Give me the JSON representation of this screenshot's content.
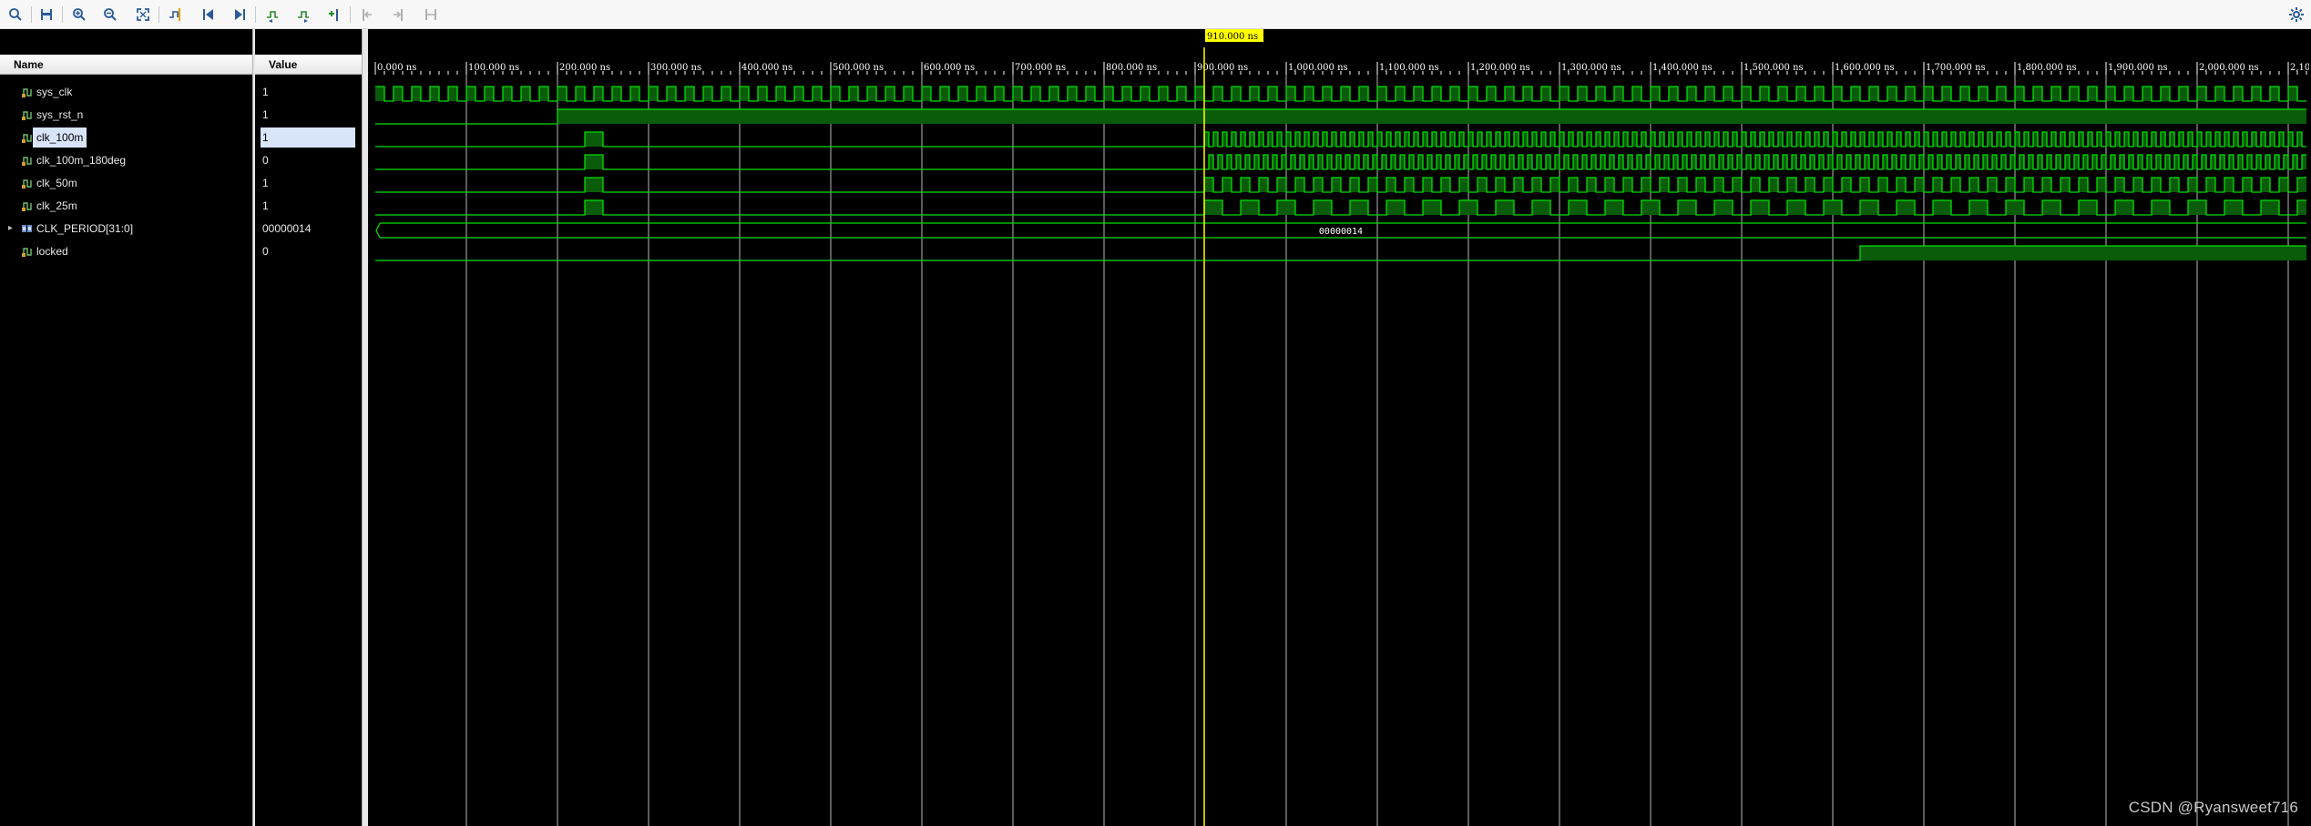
{
  "toolbar": {
    "buttons": [
      {
        "name": "zoom-search-icon"
      },
      {
        "name": "save-icon"
      },
      {
        "name": "zoom-in-icon"
      },
      {
        "name": "zoom-out-icon"
      },
      {
        "name": "zoom-fit-icon"
      },
      {
        "name": "go-to-cursor-icon"
      },
      {
        "name": "go-to-time-zero-icon"
      },
      {
        "name": "go-to-last-time-icon"
      },
      {
        "name": "previous-transition-icon"
      },
      {
        "name": "next-transition-icon"
      },
      {
        "name": "add-marker-icon"
      },
      {
        "name": "previous-marker-icon"
      },
      {
        "name": "next-marker-icon"
      },
      {
        "name": "swap-cursors-icon"
      }
    ],
    "settings_icon": "gear-icon"
  },
  "columns": {
    "name_header": "Name",
    "value_header": "Value"
  },
  "signals": [
    {
      "name": "sys_clk",
      "value": "1",
      "type": "bit",
      "icon": "bit-signal-icon"
    },
    {
      "name": "sys_rst_n",
      "value": "1",
      "type": "bit",
      "icon": "bit-signal-icon"
    },
    {
      "name": "clk_100m",
      "value": "1",
      "type": "bit",
      "icon": "bit-signal-icon",
      "selected": true
    },
    {
      "name": "clk_100m_180deg",
      "value": "0",
      "type": "bit",
      "icon": "bit-signal-icon"
    },
    {
      "name": "clk_50m",
      "value": "1",
      "type": "bit",
      "icon": "bit-signal-icon"
    },
    {
      "name": "clk_25m",
      "value": "1",
      "type": "bit",
      "icon": "bit-signal-icon"
    },
    {
      "name": "CLK_PERIOD[31:0]",
      "value": "00000014",
      "type": "bus",
      "icon": "bus-signal-icon",
      "bus_label": "00000014"
    },
    {
      "name": "locked",
      "value": "0",
      "type": "bit",
      "icon": "bit-signal-icon"
    }
  ],
  "timeline": {
    "unit": "ns",
    "start": 0,
    "end": 2120,
    "major_step": 100,
    "tick_labels": [
      "0.000 ns",
      "100.000 ns",
      "200.000 ns",
      "300.000 ns",
      "400.000 ns",
      "500.000 ns",
      "600.000 ns",
      "700.000 ns",
      "800.000 ns",
      "900.000 ns",
      "1,000.000 ns",
      "1,100.000 ns",
      "1,200.000 ns",
      "1,300.000 ns",
      "1,400.000 ns",
      "1,500.000 ns",
      "1,600.000 ns",
      "1,700.000 ns",
      "1,800.000 ns",
      "1,900.000 ns",
      "2,000.000 ns",
      "2,100.000 ns"
    ],
    "cursor_time": 910,
    "cursor_label": "910.000 ns"
  },
  "waveforms": {
    "sys_clk": {
      "kind": "clock",
      "period": 20,
      "start": 0
    },
    "sys_rst_n": {
      "kind": "step",
      "initial": 0,
      "edges": [
        200
      ]
    },
    "clk_100m": {
      "kind": "pll_clock",
      "period": 10,
      "lock_start": 910,
      "pulse": [
        230,
        250
      ]
    },
    "clk_100m_180deg": {
      "kind": "pll_clock",
      "period": 10,
      "phase": 5,
      "lock_start": 910,
      "pulse": [
        230,
        250
      ]
    },
    "clk_50m": {
      "kind": "pll_clock",
      "period": 20,
      "lock_start": 910,
      "pulse": [
        230,
        250
      ]
    },
    "clk_25m": {
      "kind": "pll_clock",
      "period": 40,
      "lock_start": 910,
      "pulse": [
        230,
        250
      ]
    },
    "CLK_PERIOD": {
      "kind": "bus_constant",
      "value": "00000014",
      "label_time": 1060
    },
    "locked": {
      "kind": "step",
      "initial": 0,
      "edges": [
        1630
      ]
    }
  },
  "colors": {
    "wave": "#00e000",
    "wave_fill": "#0a5c0a",
    "grid": "#b8b8b8",
    "cursor": "#ffff00",
    "background": "#000000",
    "selection": "#d8e4f8"
  },
  "watermark": "CSDN @Ryansweet716"
}
